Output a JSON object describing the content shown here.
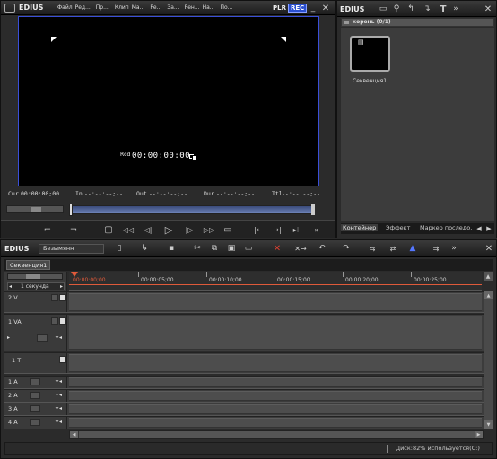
{
  "player": {
    "logo": "EDIUS",
    "menu": [
      "Файл",
      "Ред...",
      "Пр...",
      "Клип",
      "Ма...",
      "Ре...",
      "За...",
      "Рен...",
      "На...",
      "По..."
    ],
    "plr": "PLR",
    "rec": "REC",
    "timecode": "00:00:00:00",
    "tc_prefix": "Rcd",
    "cur_label": "Cur",
    "cur_val": "00:00:00;00",
    "in_label": "In",
    "in_val": "--:--:--;--",
    "out_label": "Out",
    "out_val": "--:--:--;--",
    "dur_label": "Dur",
    "dur_val": "--:--:--;--",
    "ttl_label": "Ttl",
    "ttl_val": "--:--:--;--"
  },
  "bin": {
    "logo": "EDIUS",
    "folder": "корень (0/1)",
    "clip_label": "Секвенция1",
    "tabs": [
      "Контейнер",
      "Эффект",
      "Маркер последо..."
    ]
  },
  "timeline": {
    "logo": "EDIUS",
    "project": "Безымянн",
    "sequence_tab": "Секвенция1",
    "scale": "1 секунда",
    "ruler": [
      "00:00:00;00",
      "00:00:05;00",
      "00:00:10;00",
      "00:00:15;00",
      "00:00:20;00",
      "00:00:25;00"
    ],
    "tracks": [
      {
        "label": "2 V"
      },
      {
        "label": "1 VA"
      },
      {
        "label": "1 T"
      },
      {
        "label": "1 A"
      },
      {
        "label": "2 A"
      },
      {
        "label": "3 A"
      },
      {
        "label": "4 A"
      }
    ],
    "status": "Диск:82% используется(C:)"
  },
  "colors": {
    "accent": "#2f55c8",
    "rec": "#2a4fd0",
    "screen_border": "#3a4fd8"
  }
}
